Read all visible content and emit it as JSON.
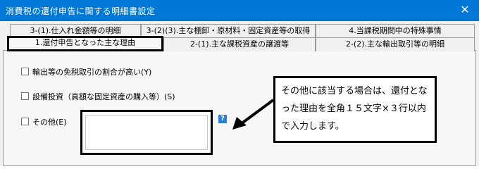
{
  "window": {
    "title": "消費税の還付申告に関する明細書設定",
    "close_glyph": "✕"
  },
  "tabs_row1": [
    {
      "label": "3-(1).仕入れ金額等の明細"
    },
    {
      "label": "3-(2)(3).主な棚卸・原材料・固定資産等の取得"
    },
    {
      "label": "4.当課税期間中の特殊事情"
    }
  ],
  "tabs_row2": [
    {
      "label": "1.還付申告となった主な理由",
      "selected": true
    },
    {
      "label": "2-(1).主な課税資産の譲渡等"
    },
    {
      "label": "2-(2).主な輸出取引等の明細"
    }
  ],
  "options": [
    {
      "label": "輸出等の免税取引の割合が高い(Y)",
      "checked": false
    },
    {
      "label": "設備投資（高額な固定資産の購入等）(S)",
      "checked": false
    },
    {
      "label": "その他(E)",
      "checked": false
    }
  ],
  "other_reason": {
    "value": ""
  },
  "help": {
    "glyph": "?"
  },
  "callout": {
    "text": "その他に該当する場合は、還付となった理由を全角１５文字×３行以内で入力します。"
  }
}
